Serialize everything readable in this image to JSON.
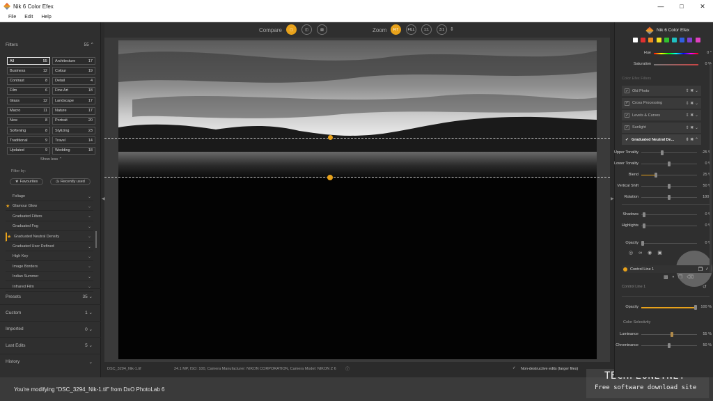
{
  "window": {
    "title": "Nik 6 Color Efex",
    "min": "—",
    "max": "□",
    "close": "✕"
  },
  "menu": {
    "file": "File",
    "edit": "Edit",
    "help": "Help"
  },
  "left": {
    "filters_label": "Filters",
    "filters_count": "55",
    "chips": [
      {
        "label": "All",
        "count": "55"
      },
      {
        "label": "Architecture",
        "count": "17"
      },
      {
        "label": "Business",
        "count": "12"
      },
      {
        "label": "Colour",
        "count": "19"
      },
      {
        "label": "Contrast",
        "count": "8"
      },
      {
        "label": "Detail",
        "count": "4"
      },
      {
        "label": "Film",
        "count": "6"
      },
      {
        "label": "Fine Art",
        "count": "18"
      },
      {
        "label": "Glass",
        "count": "12"
      },
      {
        "label": "Landscape",
        "count": "17"
      },
      {
        "label": "Macro",
        "count": "11"
      },
      {
        "label": "Nature",
        "count": "17"
      },
      {
        "label": "New",
        "count": "8"
      },
      {
        "label": "Portrait",
        "count": "20"
      },
      {
        "label": "Softening",
        "count": "8"
      },
      {
        "label": "Stylizing",
        "count": "23"
      },
      {
        "label": "Traditional",
        "count": "9"
      },
      {
        "label": "Travel",
        "count": "14"
      },
      {
        "label": "Updated",
        "count": "9"
      },
      {
        "label": "Wedding",
        "count": "18"
      }
    ],
    "show_less": "Show less",
    "filter_by": "Filter by:",
    "favourites": "Favourites",
    "recently_used": "Recently used",
    "filter_list": [
      {
        "label": "Foliage",
        "star": false
      },
      {
        "label": "Glamour Glow",
        "star": true
      },
      {
        "label": "Graduated Filters",
        "star": false
      },
      {
        "label": "Graduated Fog",
        "star": false
      },
      {
        "label": "Graduated Neutral Density",
        "star": true
      },
      {
        "label": "Graduated User Defined",
        "star": false
      },
      {
        "label": "High Key",
        "star": false
      },
      {
        "label": "Image Borders",
        "star": false
      },
      {
        "label": "Indian Summer",
        "star": false
      },
      {
        "label": "Infrared Film",
        "star": false
      }
    ],
    "sections": [
      {
        "label": "Presets",
        "count": "35"
      },
      {
        "label": "Custom",
        "count": "1"
      },
      {
        "label": "Imported",
        "count": "0"
      },
      {
        "label": "Last Edits",
        "count": "5"
      },
      {
        "label": "History",
        "count": ""
      }
    ]
  },
  "toolbar": {
    "compare": "Compare",
    "zoom": "Zoom",
    "fit": "FIT",
    "fill": "FILL",
    "one_to_one": "1:1",
    "three_to_one": "3:1"
  },
  "status": {
    "file": "DSC_3294_Nik-1.tif",
    "info": "24.1 MP, ISO: 100, Camera Manufacturer: NIKON CORPORATION, Camera Model: NIKON Z 6",
    "nondestructive": "Non-destructive edits (larger files)"
  },
  "notice": "You're modifying “DSC_3294_Nik-1.tif” from DxO PhotoLab 6",
  "watermark": {
    "title": "TECHFEONE.NET",
    "subtitle": "Free software download site"
  },
  "right": {
    "logo_text": "Nik 6 Color Efex",
    "hue_label": "Hue",
    "hue_value": "0 °",
    "saturation_label": "Saturation",
    "saturation_value": "0 %",
    "color_efex_filters": "Color Efex Filters",
    "stack": [
      "Old Photo",
      "Cross Processing",
      "Levels & Curves",
      "Sunlight"
    ],
    "active_filter": "Graduated Neutral De...",
    "sliders": [
      {
        "label": "Upper Tonality",
        "value": "-25 %",
        "pos": 0.37
      },
      {
        "label": "Lower Tonality",
        "value": "0 %",
        "pos": 0.5
      },
      {
        "label": "Blend",
        "value": "25 %",
        "pos": 0.25
      },
      {
        "label": "Vertical Shift",
        "value": "50 %",
        "pos": 0.5
      },
      {
        "label": "Rotation",
        "value": "180 °",
        "pos": 0.5
      }
    ],
    "sliders2": [
      {
        "label": "Shadows",
        "value": "0 %",
        "pos": 0.02
      },
      {
        "label": "Highlights",
        "value": "0 %",
        "pos": 0.02
      }
    ],
    "opacity_label": "Opacity",
    "opacity_value": "0 %",
    "control_line_item": "Control Line 1",
    "control_line_header": "Control Line 1",
    "cl_opacity_label": "Opacity",
    "cl_opacity_value": "100 %",
    "color_selectivity": "Color Selectivity",
    "luminance_label": "Luminance",
    "luminance_value": "55 %",
    "chrominance_label": "Chrominance",
    "chrominance_value": "50 %"
  }
}
